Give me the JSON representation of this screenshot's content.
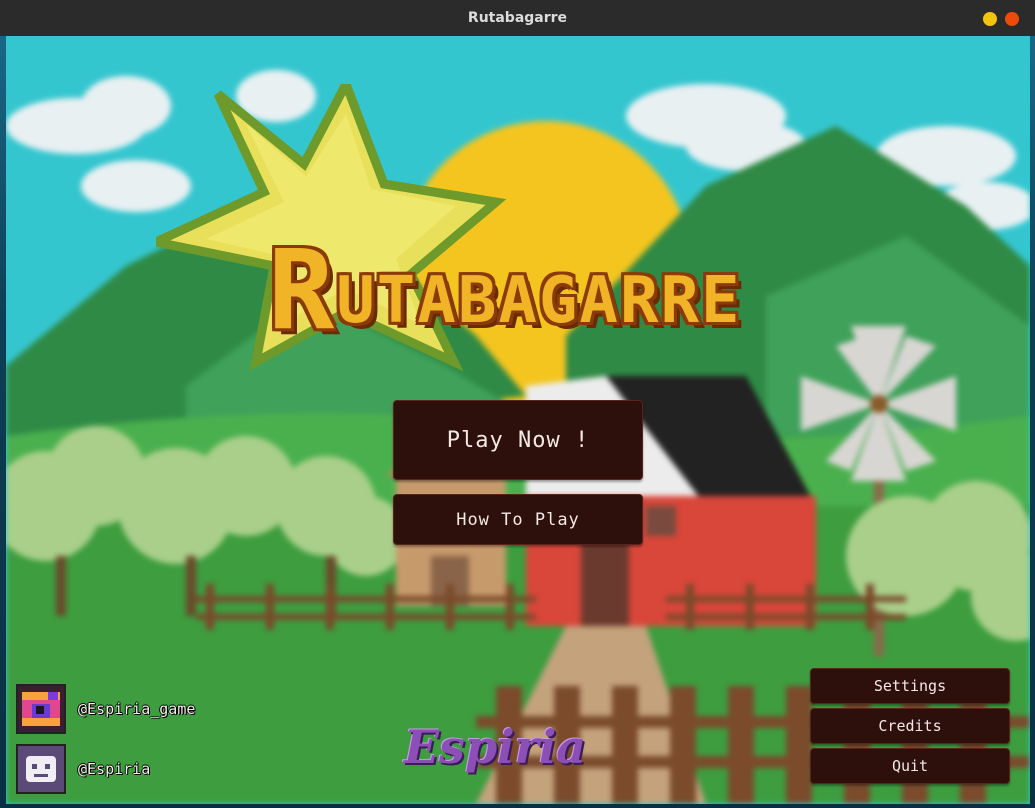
{
  "window": {
    "title": "Rutabagarre"
  },
  "game": {
    "logo_title": "Rutabagarre",
    "logo_first": "R",
    "logo_rest": "UTABAGARRE"
  },
  "menu": {
    "play_label": "Play Now !",
    "howto_label": "How To Play",
    "settings_label": "Settings",
    "credits_label": "Credits",
    "quit_label": "Quit"
  },
  "socials": [
    {
      "handle": "@Espiria_game",
      "icon": "game-avatar-icon"
    },
    {
      "handle": "@Espiria",
      "icon": "studio-avatar-icon"
    }
  ],
  "studio": {
    "logo_text": "Espiria"
  },
  "colors": {
    "button_bg": "#2d0f0c",
    "button_text": "#f3e9e3",
    "logo_fill": "#f2b427",
    "logo_outline": "#8a3b08",
    "star": "#e8e05a",
    "sky": "#30c8d0",
    "sun": "#f4c51f",
    "barn": "#d9463a",
    "grass": "#3a9a3e",
    "studio_logo": "#8b4fb6"
  }
}
